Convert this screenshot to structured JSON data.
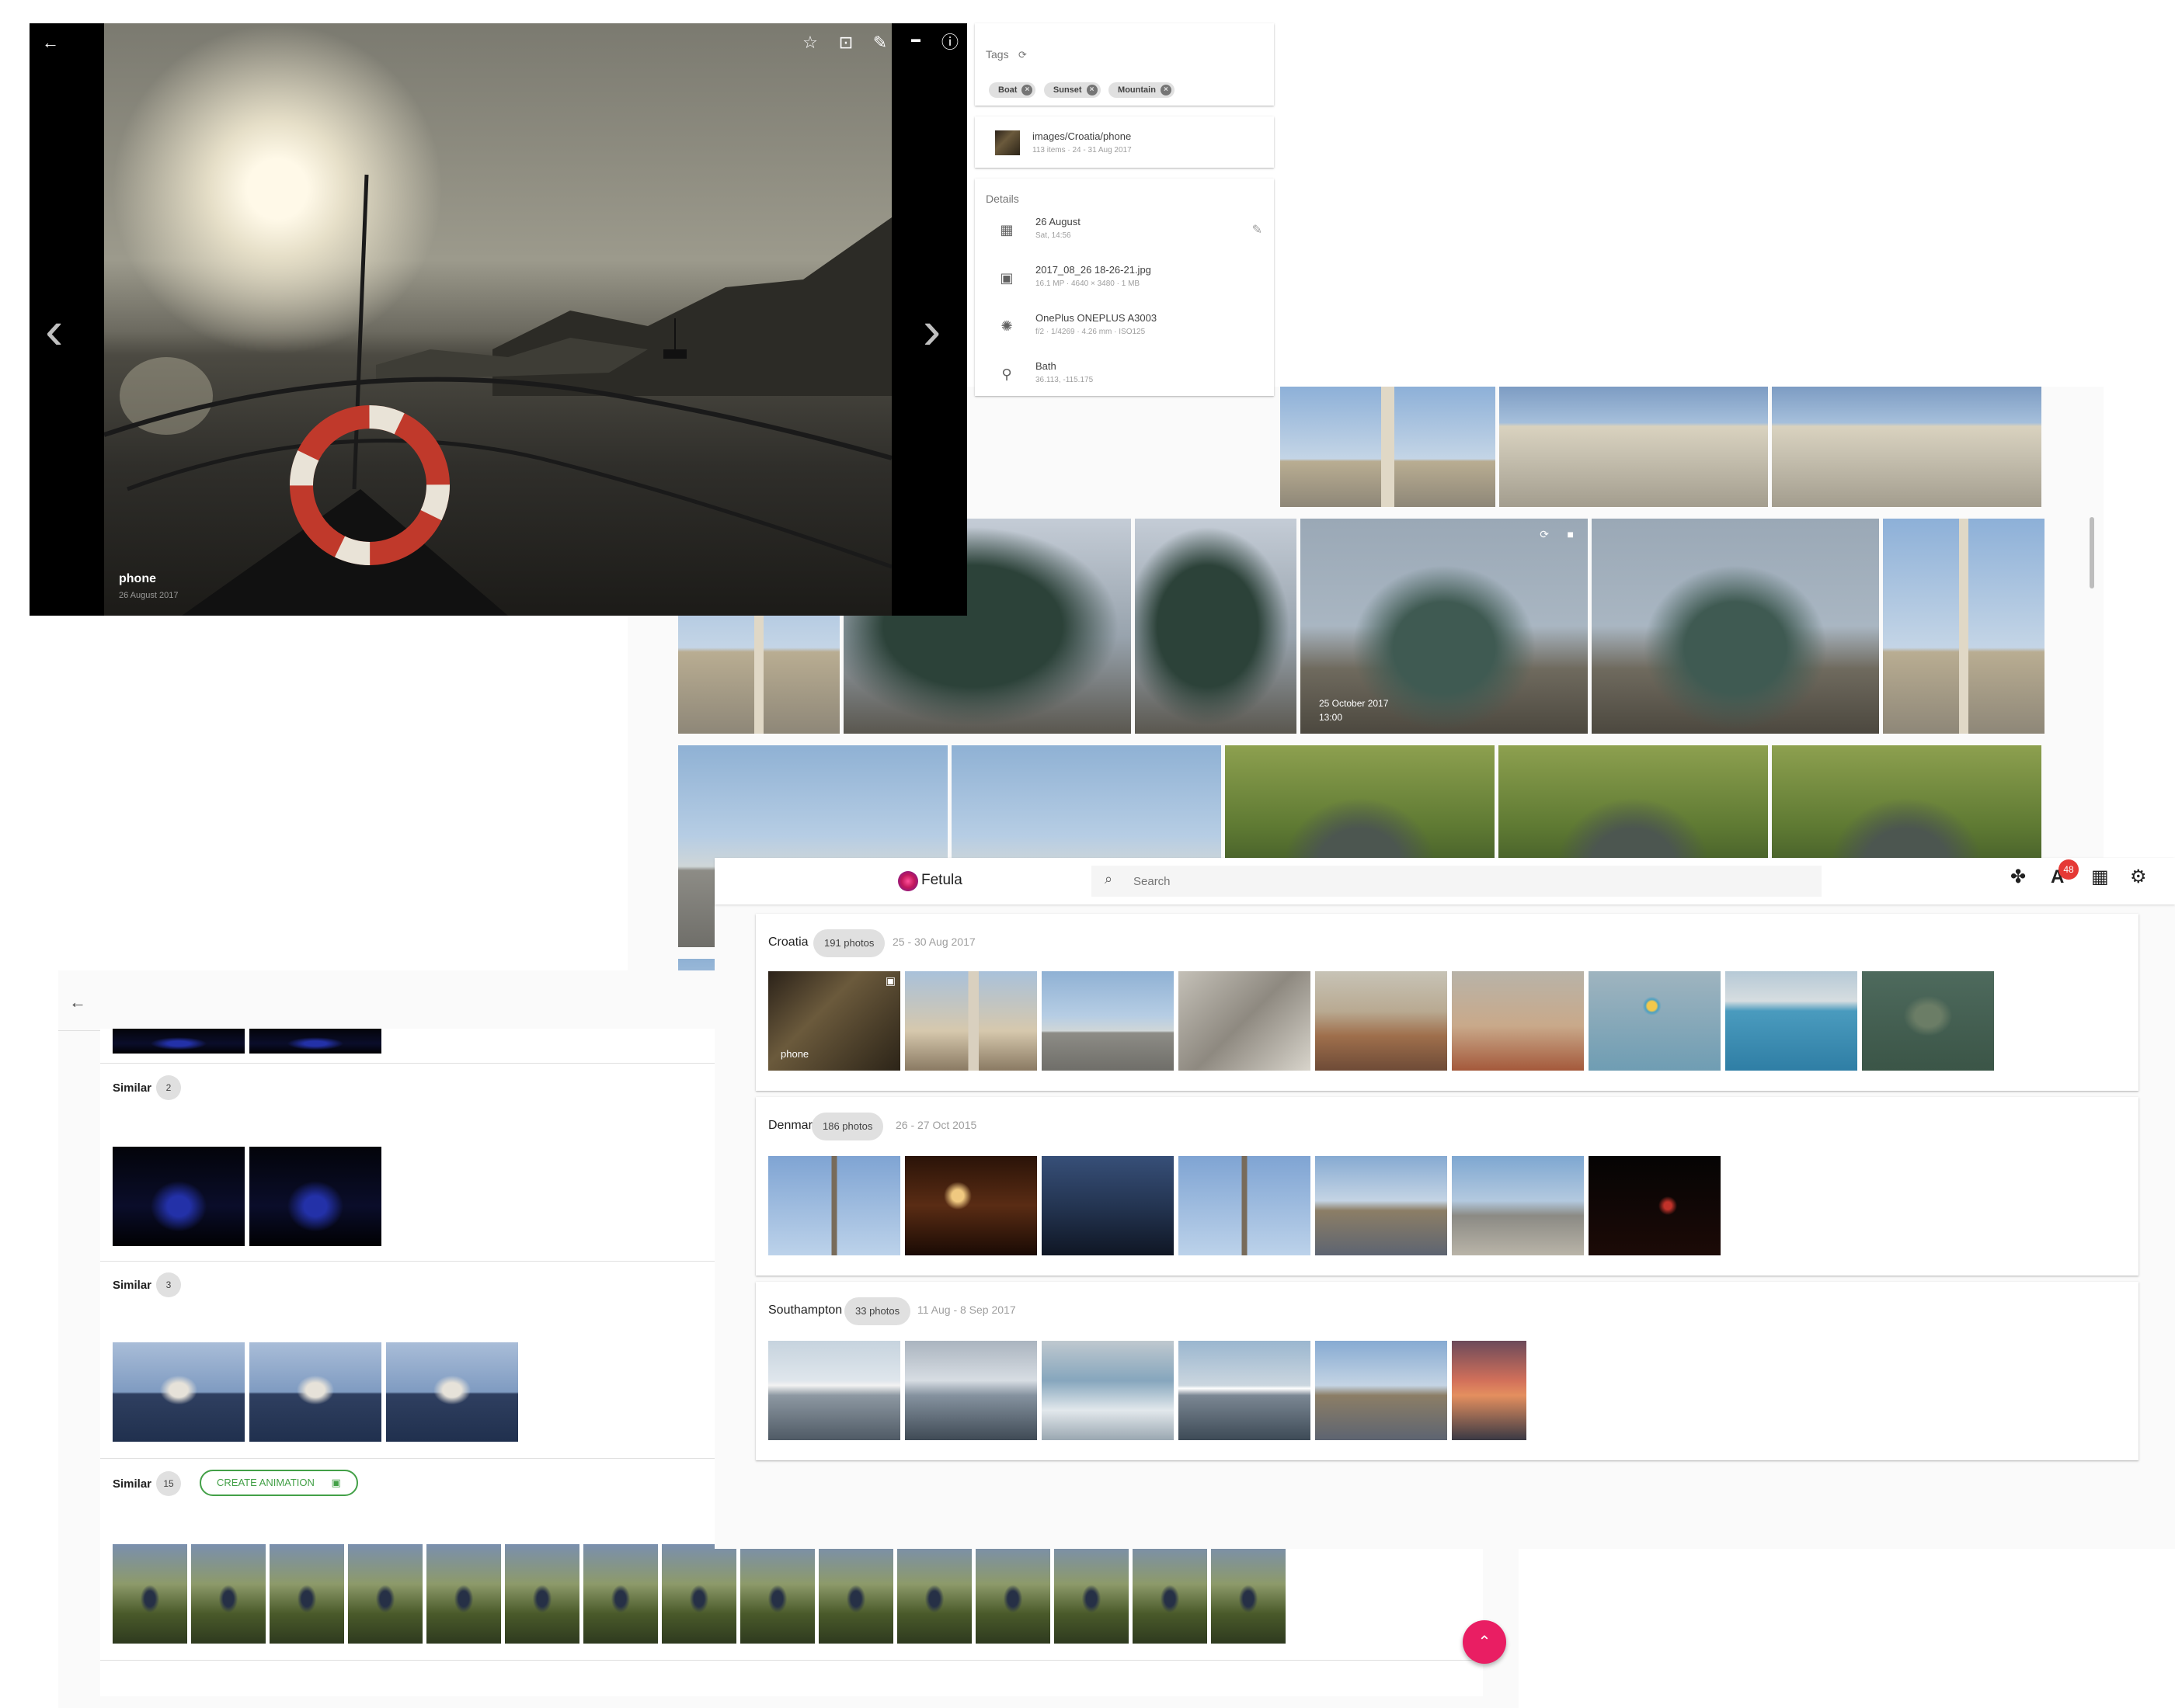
{
  "viewer": {
    "caption_title": "phone",
    "caption_date": "26 August 2017",
    "icons": [
      "back-arrow-icon",
      "star-icon",
      "crop-icon",
      "edit-icon",
      "hd-icon",
      "info-icon",
      "chevron-left-icon",
      "chevron-right-icon"
    ]
  },
  "tags": {
    "title": "Tags",
    "items": [
      "Boat",
      "Sunset",
      "Mountain"
    ]
  },
  "album_ref": {
    "path": "images/Croatia/phone",
    "meta": "113 items · 24 - 31 Aug 2017"
  },
  "details": {
    "title": "Details",
    "date": "26 August",
    "time": "Sat, 14:56",
    "filename": "2017_08_26 18-26-21.jpg",
    "file_meta": "16.1 MP · 4640 × 3480 · 1 MB",
    "camera": "OnePlus ONEPLUS A3003",
    "camera_meta": "f/2 · 1/4269 · 4.26 mm · ISO125",
    "location": "Bath",
    "coords": "36.113, -115.175"
  },
  "grid": {
    "hover_date": "25 October 2017",
    "hover_time": "13:00"
  },
  "similar": {
    "sections": [
      {
        "label": "Similar",
        "count": "2"
      },
      {
        "label": "Similar",
        "count": "3"
      },
      {
        "label": "Similar",
        "count": "15",
        "button": "CREATE ANIMATION"
      }
    ]
  },
  "app": {
    "name": "Fetula",
    "search_placeholder": "Search",
    "notification_count": "48"
  },
  "albums": [
    {
      "title": "Croatia",
      "count": "191 photos",
      "dates": "25 - 30 Aug 2017",
      "first_label": "phone"
    },
    {
      "title": "Denmark",
      "count": "186 photos",
      "dates": "26 - 27 Oct 2015"
    },
    {
      "title": "Southampton",
      "count": "33 photos",
      "dates": "11 Aug - 8 Sep 2017"
    }
  ],
  "colors": {
    "accent": "#e91e63",
    "animation": "#43a047",
    "badge": "#e53935"
  }
}
